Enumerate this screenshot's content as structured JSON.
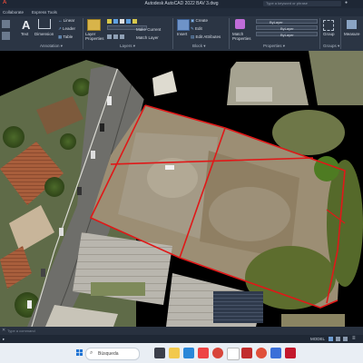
{
  "title": "Autodesk AutoCAD 2022   BAV 3.dwg",
  "search_placeholder": "Type a keyword or phrase",
  "tabs": [
    "Collaborate",
    "Express Tools"
  ],
  "ribbon": {
    "text_label": "Text",
    "dimension_label": "Dimension",
    "linear": "Linear",
    "leader": "Leader",
    "table": "Table",
    "layer_properties": "Layer\nProperties",
    "make_current": "Make Current",
    "match_layer": "Match Layer",
    "insert": "Insert",
    "create": "Create",
    "edit": "Edit",
    "edit_attributes": "Edit Attributes",
    "match_properties": "Match\nProperties",
    "bylayer_1": "ByLayer",
    "bylayer_2": "ByLayer",
    "bylayer_3": "ByLayer",
    "group_label": "Group",
    "measure_label": "Measure"
  },
  "panels": {
    "annotation": "Annotation ▾",
    "layers": "Layers ▾",
    "block": "Block ▾",
    "properties": "Properties ▾",
    "groups": "Groups ▾"
  },
  "command": {
    "placeholder": "Type a command"
  },
  "status": {
    "model": "MODEL"
  },
  "taskbar": {
    "search_label": "Búsqueda"
  },
  "colors": {
    "boundary": "#e01818",
    "ribbon_bg": "#2b3544",
    "titlebar_bg": "#1e2735"
  }
}
